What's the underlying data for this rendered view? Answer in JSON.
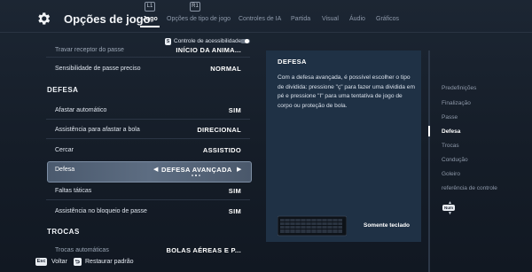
{
  "header": {
    "title": "Opções de jogo",
    "bumper_left": "L1",
    "bumper_right": "R1",
    "tabs": [
      {
        "label": "Jogo",
        "active": true
      },
      {
        "label": "Opções de tipo de jogo"
      },
      {
        "label": "Controles de IA"
      },
      {
        "label": "Partida"
      },
      {
        "label": "Visual"
      },
      {
        "label": "Áudio"
      },
      {
        "label": "Gráficos"
      }
    ]
  },
  "accessibility": {
    "key": "S",
    "label": "Controle de acessibilidade",
    "enabled": false
  },
  "settings": {
    "partial_top": {
      "label": "Travar receptor do passe",
      "value": "INÍCIO DA ANIMA..."
    },
    "row_pass_sensitivity": {
      "label": "Sensibilidade de passe preciso",
      "value": "NORMAL"
    },
    "section_defense": "DEFESA",
    "row_auto_clear": {
      "label": "Afastar automático",
      "value": "SIM"
    },
    "row_clear_assist": {
      "label": "Assistência para afastar a bola",
      "value": "DIRECIONAL"
    },
    "row_contain": {
      "label": "Cercar",
      "value": "ASSISTIDO"
    },
    "row_defense": {
      "label": "Defesa",
      "value": "DEFESA AVANÇADA",
      "arrow_left": "◀",
      "arrow_right": "▶"
    },
    "row_tactical_fouls": {
      "label": "Faltas táticas",
      "value": "SIM"
    },
    "row_pass_block": {
      "label": "Assistência no bloqueio de passe",
      "value": "SIM"
    },
    "section_switching": "TROCAS",
    "partial_bottom": {
      "label": "Trocas automáticas",
      "value": "BOLAS AÉREAS E P..."
    }
  },
  "info": {
    "title": "DEFESA",
    "body": "Com a defesa avançada, é possível escolher o tipo de dividida: pressione \"ç\" para fazer uma dividida em pé e pressione \"I\" para uma tentativa de jogo de corpo ou proteção de bola.",
    "keyboard_label": "Somente teclado"
  },
  "nav": {
    "items": [
      {
        "label": "Predefinições"
      },
      {
        "label": "Finalização"
      },
      {
        "label": "Passe"
      },
      {
        "label": "Defesa",
        "active": true
      },
      {
        "label": "Trocas"
      },
      {
        "label": "Condução"
      },
      {
        "label": "Goleiro"
      },
      {
        "label": "referência de controle"
      }
    ],
    "num_key": "Num"
  },
  "footer": {
    "esc_key": "Esc",
    "back": "Voltar",
    "restore": "Restaurar padrão"
  },
  "colors": {
    "background": "#151d28",
    "panel": "#1f3145",
    "selected_row": "#5d6d82",
    "text": "#e6ebf2",
    "muted": "#8e99a9"
  }
}
